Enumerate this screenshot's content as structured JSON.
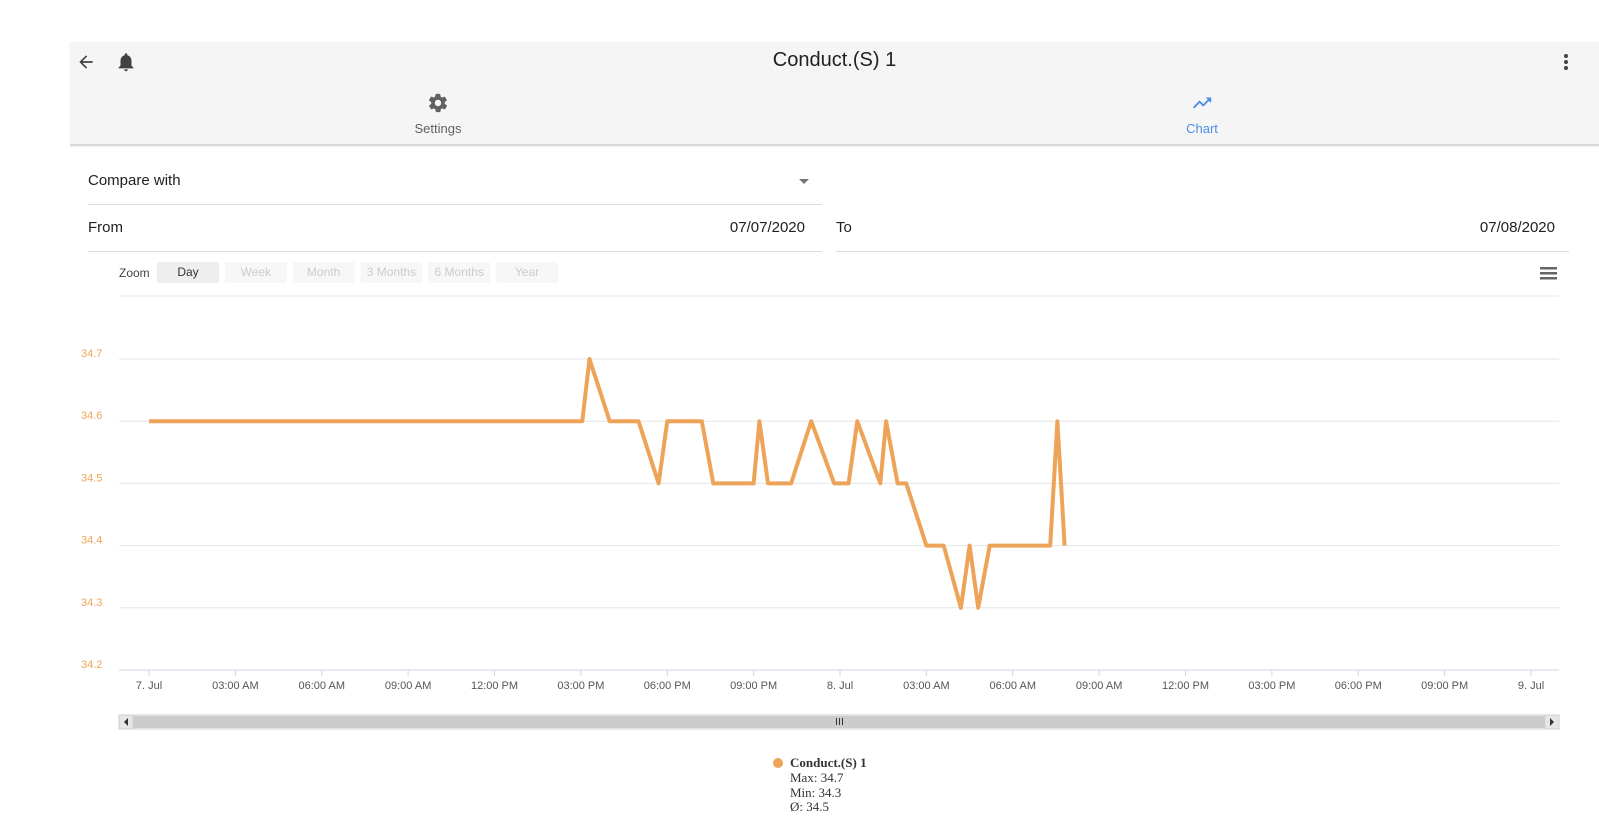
{
  "header": {
    "title": "Conduct.(S) 1"
  },
  "tabs": [
    {
      "label": "Settings"
    },
    {
      "label": "Chart"
    }
  ],
  "form": {
    "compare_label": "Compare with",
    "from_label": "From",
    "from_value": "07/07/2020",
    "to_label": "To",
    "to_value": "07/08/2020"
  },
  "zoom": {
    "label": "Zoom",
    "buttons": [
      "Day",
      "Week",
      "Month",
      "3 Months",
      "6 Months",
      "Year"
    ],
    "selected": "Day"
  },
  "colors": {
    "series": "#eda458",
    "accent": "#4a8ee3"
  },
  "chart_data": {
    "type": "line",
    "y_ticks": [
      34.2,
      34.3,
      34.4,
      34.5,
      34.6,
      34.7
    ],
    "ylim": [
      34.2,
      34.7
    ],
    "x_range_hours": [
      0,
      48
    ],
    "x_tick_labels": [
      "7. Jul",
      "03:00 AM",
      "06:00 AM",
      "09:00 AM",
      "12:00 PM",
      "03:00 PM",
      "06:00 PM",
      "09:00 PM",
      "8. Jul",
      "03:00 AM",
      "06:00 AM",
      "09:00 AM",
      "12:00 PM",
      "03:00 PM",
      "06:00 PM",
      "09:00 PM",
      "9. Jul"
    ],
    "grid": true,
    "series": [
      {
        "name": "Conduct.(S) 1",
        "x": [
          0,
          15.05,
          15.3,
          16.0,
          17.0,
          17.7,
          18.0,
          19.2,
          19.6,
          21.0,
          21.2,
          21.5,
          22.3,
          23.0,
          23.8,
          24.3,
          24.6,
          25.4,
          25.6,
          26.0,
          26.3,
          27.0,
          27.6,
          28.2,
          28.5,
          28.8,
          29.2,
          29.8,
          31.3,
          31.55,
          31.8
        ],
        "values": [
          34.6,
          34.6,
          34.7,
          34.6,
          34.6,
          34.5,
          34.6,
          34.6,
          34.5,
          34.5,
          34.6,
          34.5,
          34.5,
          34.6,
          34.5,
          34.5,
          34.6,
          34.5,
          34.6,
          34.5,
          34.5,
          34.4,
          34.4,
          34.3,
          34.4,
          34.3,
          34.4,
          34.4,
          34.4,
          34.6,
          34.4
        ]
      }
    ],
    "legend": {
      "position": "bottom-center",
      "name": "Conduct.(S) 1",
      "max": "Max: 34.7",
      "min": "Min: 34.3",
      "avg": "Ø: 34.5"
    }
  }
}
